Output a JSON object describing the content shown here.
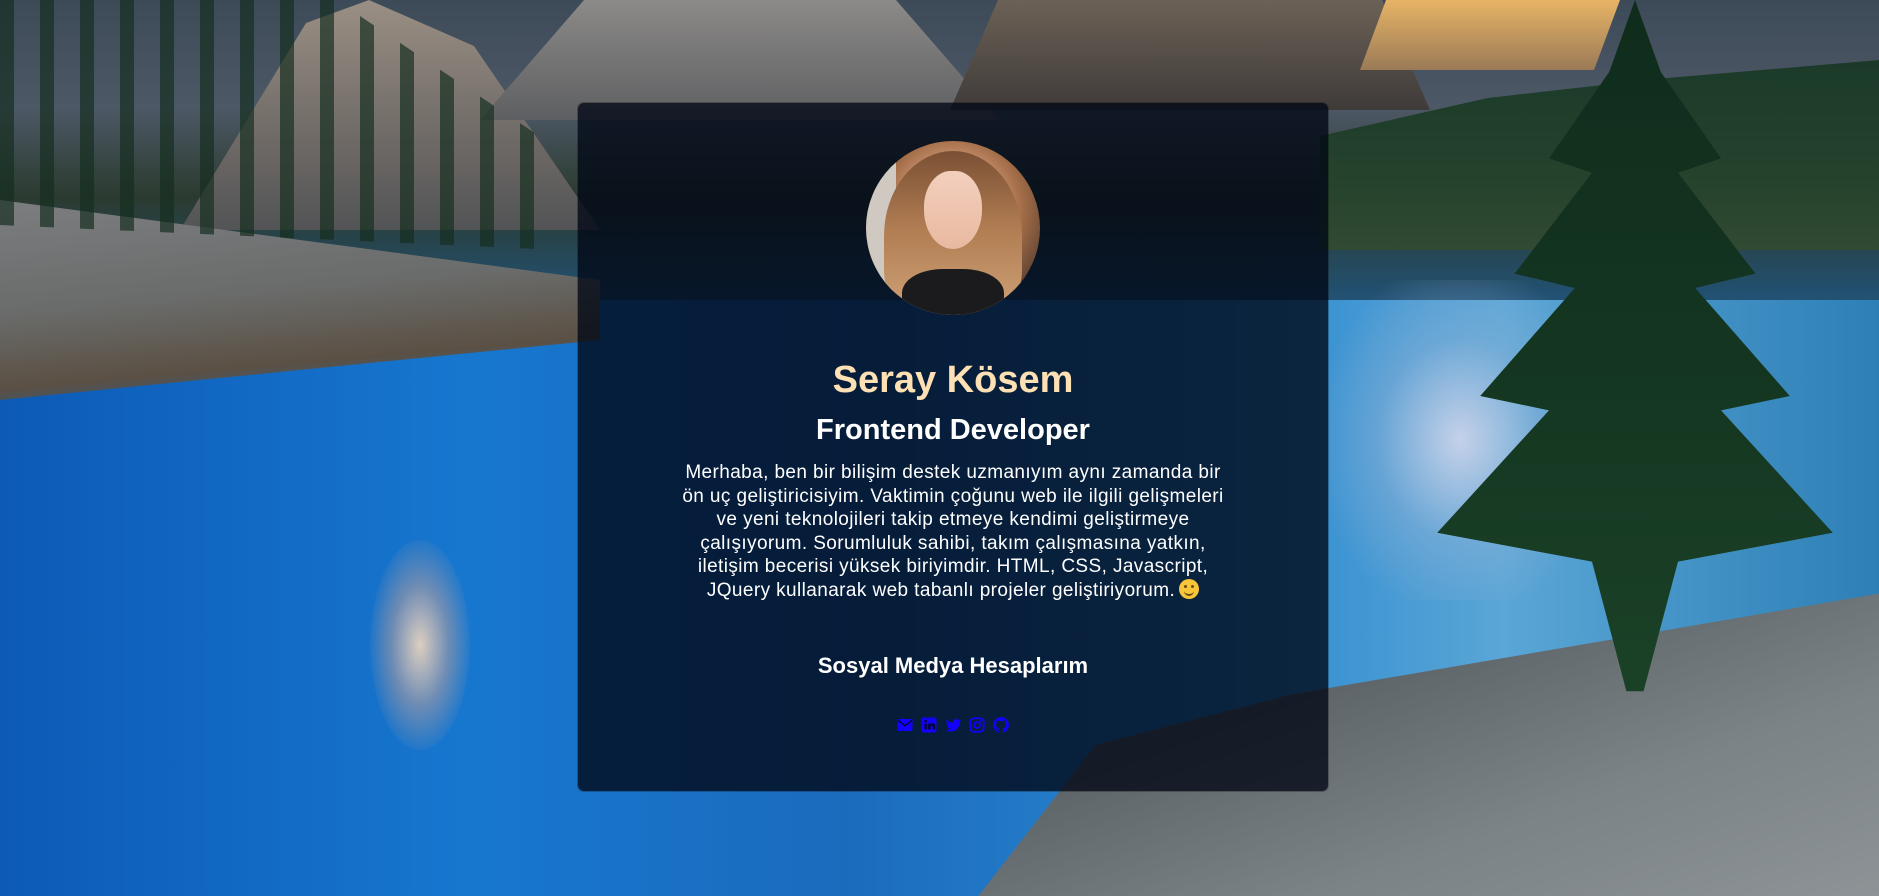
{
  "profile": {
    "name": "Seray Kösem",
    "role": "Frontend Developer",
    "bio": "Merhaba, ben bir bilişim destek uzmanıyım aynı zamanda bir ön uç geliştiricisiyim. Vaktimin çoğunu web ile ilgili gelişmeleri ve yeni teknolojileri takip etmeye kendimi geliştirmeye çalışıyorum. Sorumluluk sahibi, takım çalışmasına yatkın, iletişim becerisi yüksek biriyimdir. HTML, CSS, Javascript, JQuery kullanarak web tabanlı projeler geliştiriyorum.",
    "bio_emoji_icon": "smiley-icon"
  },
  "social": {
    "title": "Sosyal Medya Hesaplarım",
    "icons": [
      "envelope-icon",
      "linkedin-icon",
      "twitter-icon",
      "instagram-icon",
      "github-icon"
    ]
  },
  "colors": {
    "name_color": "#fde0b3",
    "icon_color": "#1400ff",
    "card_background": "rgba(0, 6, 20, 0.78)"
  }
}
